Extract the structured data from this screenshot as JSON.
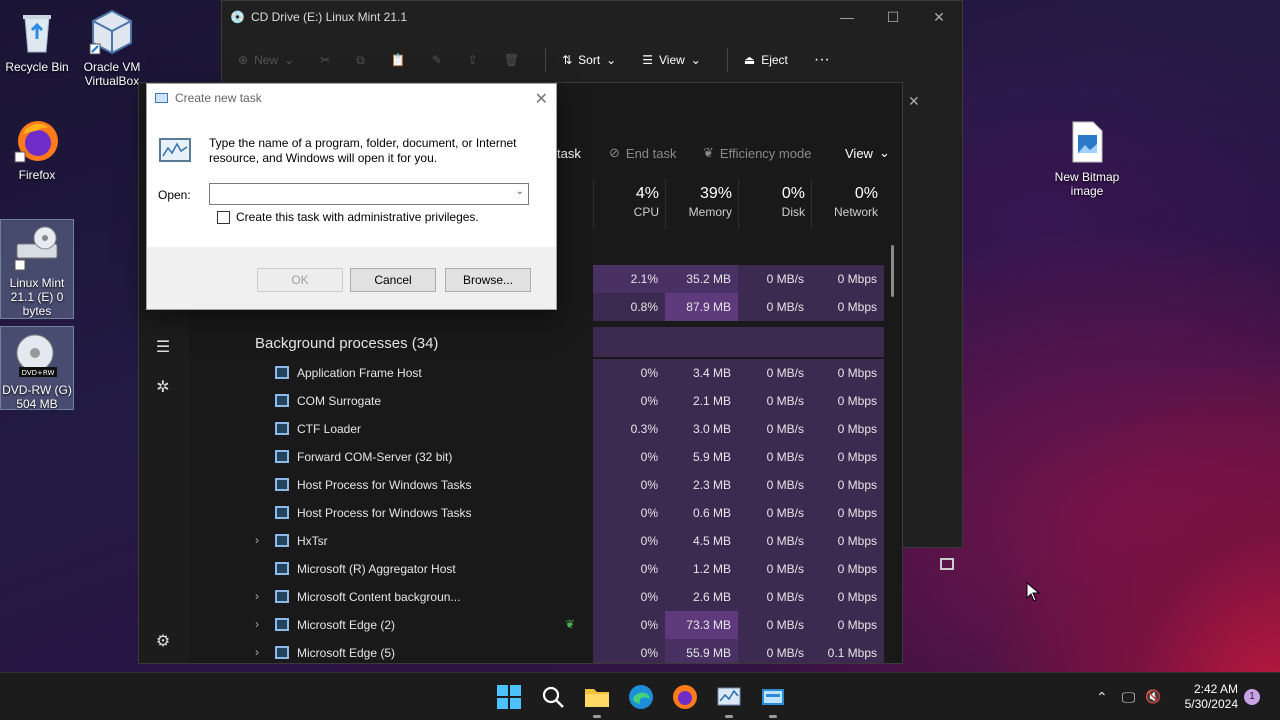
{
  "desktop": {
    "icons": [
      {
        "label": "Recycle Bin"
      },
      {
        "label": "Oracle VM VirtualBox"
      },
      {
        "label": "Firefox"
      },
      {
        "label": "Linux Mint 21.1 (E) 0 bytes"
      },
      {
        "label": "DVD-RW (G) 504 MB"
      },
      {
        "label": "New Bitmap image"
      }
    ]
  },
  "explorer": {
    "title": "CD Drive (E:) Linux Mint 21.1",
    "cmd": {
      "new": "New",
      "sort": "Sort",
      "view": "View",
      "eject": "Eject",
      "more": "···"
    }
  },
  "taskmgr": {
    "toolbar": {
      "run_task": "task",
      "end_task": "End task",
      "efficiency": "Efficiency mode",
      "view": "View"
    },
    "headers": [
      {
        "pct": "4%",
        "label": "CPU"
      },
      {
        "pct": "39%",
        "label": "Memory"
      },
      {
        "pct": "0%",
        "label": "Disk"
      },
      {
        "pct": "0%",
        "label": "Network"
      }
    ],
    "apps_rows": [
      {
        "cpu": "2.1%",
        "mem": "35.2 MB",
        "disk": "0 MB/s",
        "net": "0 Mbps"
      },
      {
        "cpu": "0.8%",
        "mem": "87.9 MB",
        "disk": "0 MB/s",
        "net": "0 Mbps"
      }
    ],
    "group_title": "Background processes (34)",
    "processes": [
      {
        "name": "Application Frame Host",
        "cpu": "0%",
        "mem": "3.4 MB",
        "disk": "0 MB/s",
        "net": "0 Mbps"
      },
      {
        "name": "COM Surrogate",
        "cpu": "0%",
        "mem": "2.1 MB",
        "disk": "0 MB/s",
        "net": "0 Mbps"
      },
      {
        "name": "CTF Loader",
        "cpu": "0.3%",
        "mem": "3.0 MB",
        "disk": "0 MB/s",
        "net": "0 Mbps"
      },
      {
        "name": "Forward COM-Server (32 bit)",
        "cpu": "0%",
        "mem": "5.9 MB",
        "disk": "0 MB/s",
        "net": "0 Mbps"
      },
      {
        "name": "Host Process for Windows Tasks",
        "cpu": "0%",
        "mem": "2.3 MB",
        "disk": "0 MB/s",
        "net": "0 Mbps"
      },
      {
        "name": "Host Process for Windows Tasks",
        "cpu": "0%",
        "mem": "0.6 MB",
        "disk": "0 MB/s",
        "net": "0 Mbps"
      },
      {
        "name": "HxTsr",
        "cpu": "0%",
        "mem": "4.5 MB",
        "disk": "0 MB/s",
        "net": "0 Mbps"
      },
      {
        "name": "Microsoft (R) Aggregator Host",
        "cpu": "0%",
        "mem": "1.2 MB",
        "disk": "0 MB/s",
        "net": "0 Mbps"
      },
      {
        "name": "Microsoft Content backgroun...",
        "cpu": "0%",
        "mem": "2.6 MB",
        "disk": "0 MB/s",
        "net": "0 Mbps"
      },
      {
        "name": "Microsoft Edge (2)",
        "cpu": "0%",
        "mem": "73.3 MB",
        "disk": "0 MB/s",
        "net": "0 Mbps"
      },
      {
        "name": "Microsoft Edge (5)",
        "cpu": "0%",
        "mem": "55.9 MB",
        "disk": "0 MB/s",
        "net": "0.1 Mbps"
      }
    ]
  },
  "dialog": {
    "title": "Create new task",
    "description": "Type the name of a program, folder, document, or Internet resource, and Windows will open it for you.",
    "open_label": "Open:",
    "open_value": "",
    "admin_label": "Create this task with administrative privileges.",
    "ok": "OK",
    "cancel": "Cancel",
    "browse": "Browse..."
  },
  "taskbar": {
    "time": "2:42 AM",
    "date": "5/30/2024",
    "notifications": "1"
  },
  "colors": {
    "accent": "#0078d4",
    "mem_highlight": "#5e3a7c"
  }
}
